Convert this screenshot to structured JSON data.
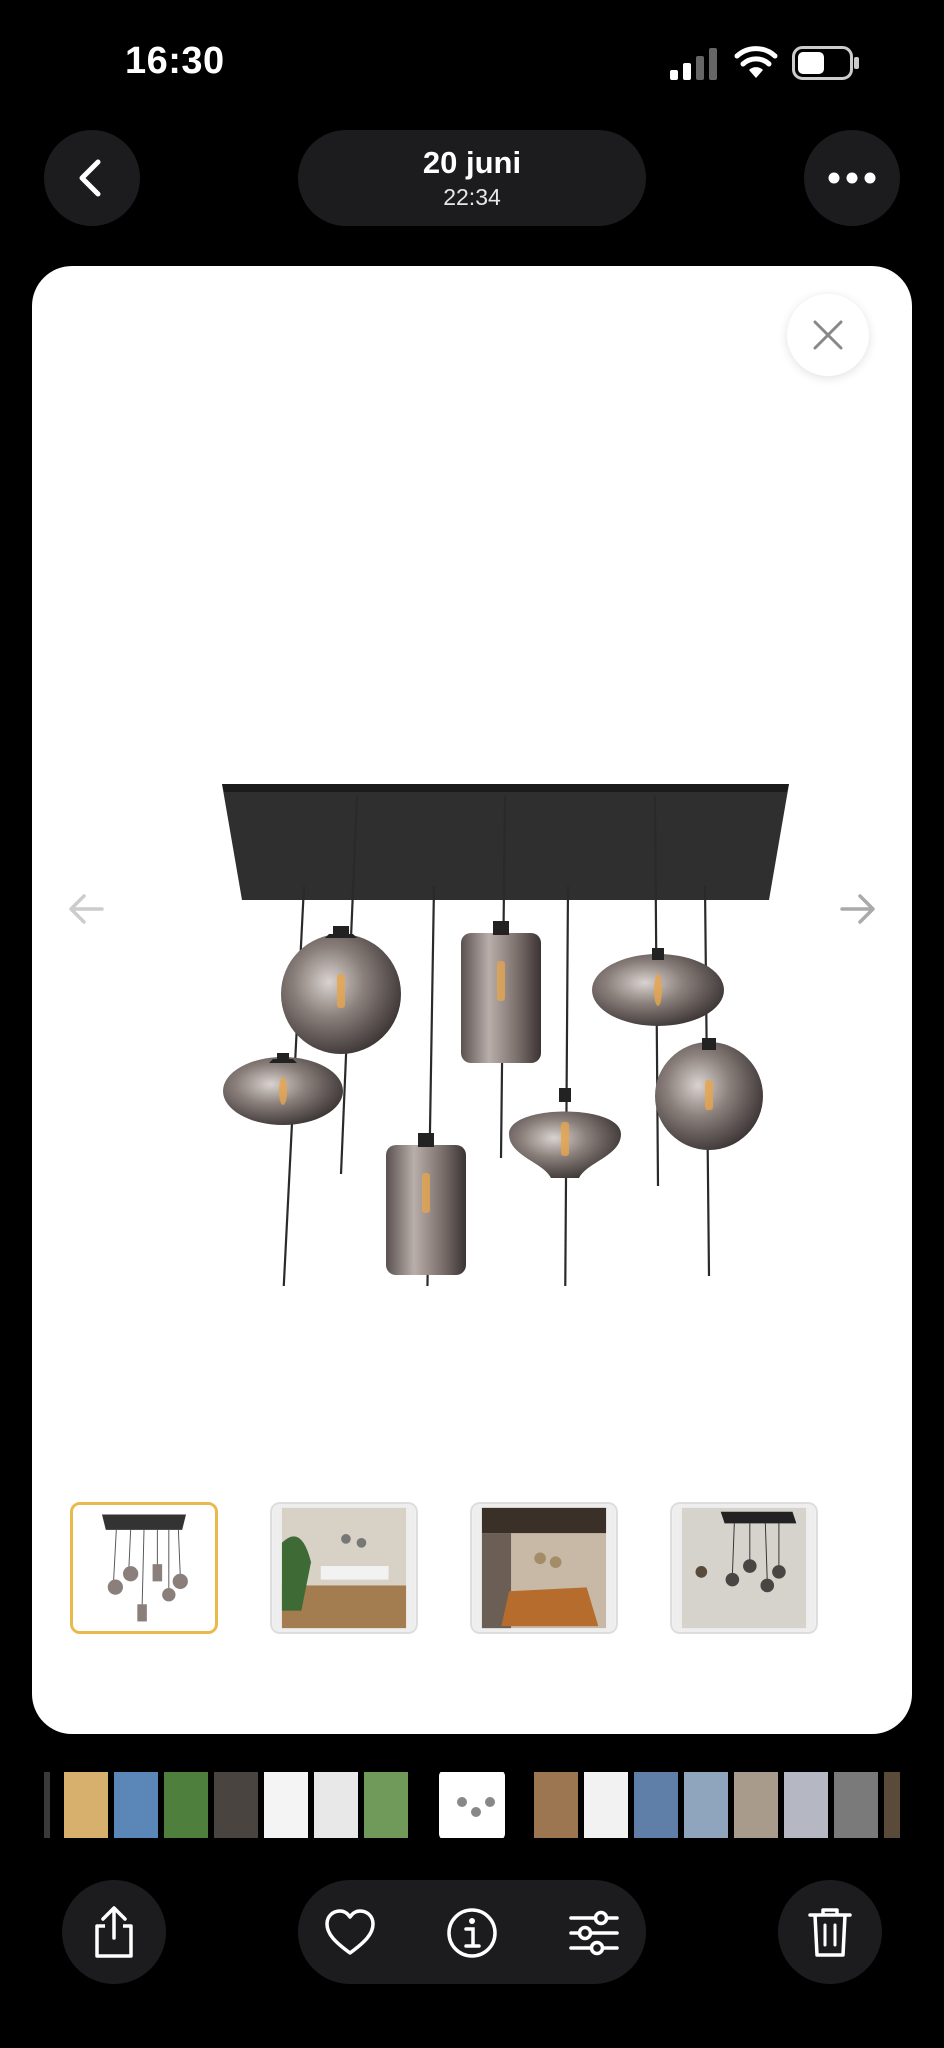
{
  "status_bar": {
    "time": "16:30"
  },
  "header": {
    "date": "20 juni",
    "time": "22:34"
  },
  "icons": {
    "back": "chevron-left-icon",
    "more": "ellipsis-icon",
    "close": "close-icon",
    "prev": "arrow-left-icon",
    "next": "arrow-right-icon",
    "share": "share-icon",
    "favorite": "heart-icon",
    "info": "info-icon",
    "adjust": "sliders-icon",
    "delete": "trash-icon"
  },
  "thumbnails": [
    {
      "name": "product-image",
      "active": true
    },
    {
      "name": "room-image-1",
      "active": false
    },
    {
      "name": "room-image-2",
      "active": false
    },
    {
      "name": "room-image-3",
      "active": false
    }
  ],
  "colors": {
    "background": "#000000",
    "button": "#1c1c1e",
    "active_thumb": "#e9b949"
  }
}
